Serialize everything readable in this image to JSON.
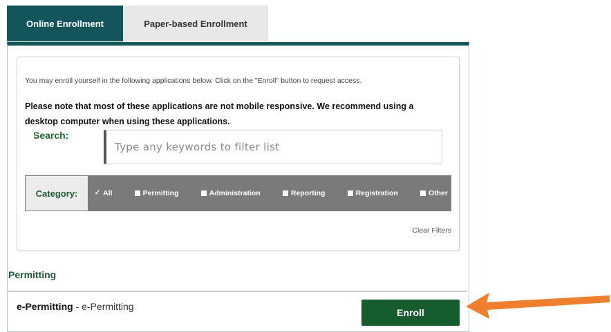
{
  "tabs": [
    {
      "label": "Online Enrollment",
      "active": true
    },
    {
      "label": "Paper-based Enrollment",
      "active": false
    }
  ],
  "intro_text": "You may enroll yourself in the following applications below. Click on the \"Enroll\" button to request access.",
  "note_text": "Please note that most of these applications are not mobile responsive. We recommend using a desktop computer when using these applications.",
  "search": {
    "label": "Search:",
    "placeholder": "Type any keywords to filter list",
    "value": ""
  },
  "category": {
    "label": "Category:",
    "options": [
      {
        "label": "All",
        "checked": true
      },
      {
        "label": "Permitting",
        "checked": false
      },
      {
        "label": "Administration",
        "checked": false
      },
      {
        "label": "Reporting",
        "checked": false
      },
      {
        "label": "Registration",
        "checked": false
      },
      {
        "label": "Other",
        "checked": false
      }
    ]
  },
  "clear_filters": "Clear Filters",
  "section": {
    "heading": "Permitting",
    "apps": [
      {
        "name": "e-Permitting",
        "description": " - e-Permitting",
        "button_label": "Enroll"
      }
    ]
  },
  "colors": {
    "tab_active": "#14555b",
    "enroll_button": "#175c2e",
    "annotation_arrow": "#ef7f2e"
  },
  "icons": {
    "checked": "checkmark-icon",
    "unchecked": "checkbox-icon",
    "annotation": "arrow-left-icon"
  }
}
